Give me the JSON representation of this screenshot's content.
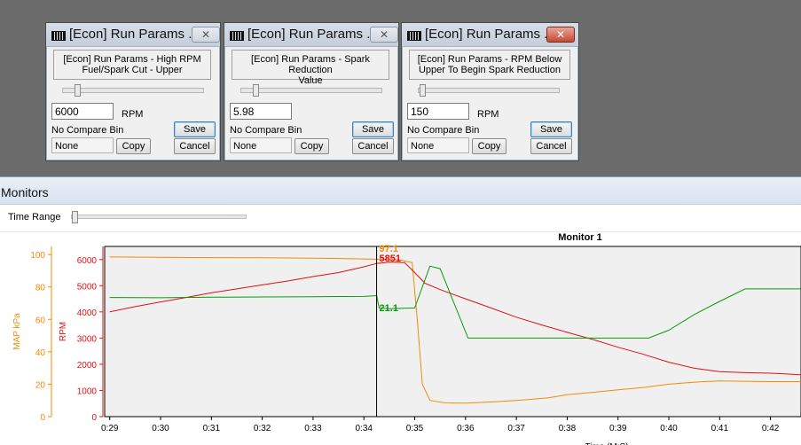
{
  "dialogs": [
    {
      "title": "[Econ] Run Params ...",
      "description_line1": "[Econ] Run Params - High RPM",
      "description_line2": "Fuel/Spark Cut - Upper",
      "value": "6000",
      "unit": "RPM",
      "save_label": "Save",
      "compare_label": "No Compare Bin",
      "compare_value": "None",
      "copy_label": "Copy",
      "cancel_label": "Cancel"
    },
    {
      "title": "[Econ] Run Params ...",
      "description_line1": "[Econ] Run Params - Spark Reduction",
      "description_line2": "Value",
      "value": "5.98",
      "unit": "",
      "save_label": "Save",
      "compare_label": "No Compare Bin",
      "compare_value": "None",
      "copy_label": "Copy",
      "cancel_label": "Cancel"
    },
    {
      "title": "[Econ] Run Params ...",
      "description_line1": "[Econ] Run Params - RPM Below",
      "description_line2": "Upper To Begin Spark Reduction",
      "value": "150",
      "unit": "RPM",
      "save_label": "Save",
      "compare_label": "No Compare Bin",
      "compare_value": "None",
      "copy_label": "Copy",
      "cancel_label": "Cancel"
    }
  ],
  "monitors": {
    "title": "Monitors",
    "time_range_label": "Time Range"
  },
  "colors": {
    "map": "#f28c00",
    "rpm": "#e01010",
    "third": "#0a9a0a",
    "cursor": "#000000"
  },
  "chart_data": {
    "type": "line",
    "title": "Monitor 1",
    "xlabel": "Time (M:S)",
    "x_ticks": [
      "0:29",
      "0:30",
      "0:31",
      "0:32",
      "0:33",
      "0:34",
      "0:35",
      "0:36",
      "0:37",
      "0:38",
      "0:39",
      "0:40",
      "0:41",
      "0:42"
    ],
    "xlim": [
      28.9,
      42.6
    ],
    "cursor_x": 34.25,
    "axes": [
      {
        "label": "MAP kPa",
        "ylim": [
          0,
          105
        ],
        "ticks": [
          0,
          20,
          40,
          60,
          80,
          100
        ],
        "side": "left-outer"
      },
      {
        "label": "RPM",
        "ylim": [
          0,
          6500
        ],
        "ticks": [
          0,
          1000,
          2000,
          3000,
          4000,
          5000,
          6000
        ],
        "side": "left-inner"
      }
    ],
    "series": [
      {
        "axis": 0,
        "cursor_label": "97.1",
        "points": [
          [
            29.0,
            98.5
          ],
          [
            30,
            98.3
          ],
          [
            31,
            98.1
          ],
          [
            32,
            98.0
          ],
          [
            33,
            97.8
          ],
          [
            34.25,
            97.1
          ],
          [
            34.7,
            96.8
          ],
          [
            34.95,
            95
          ],
          [
            35.05,
            60
          ],
          [
            35.15,
            20
          ],
          [
            35.3,
            10
          ],
          [
            35.6,
            8.5
          ],
          [
            36,
            8.3
          ],
          [
            36.5,
            9
          ],
          [
            37,
            10
          ],
          [
            37.6,
            11.5
          ],
          [
            38,
            13.5
          ],
          [
            38.5,
            15
          ],
          [
            39,
            16.5
          ],
          [
            39.5,
            18
          ],
          [
            40,
            20
          ],
          [
            40.6,
            21.5
          ],
          [
            41,
            22
          ],
          [
            41.5,
            21.8
          ],
          [
            42,
            21.6
          ],
          [
            42.6,
            21.6
          ]
        ]
      },
      {
        "axis": 1,
        "cursor_label": "5851",
        "points": [
          [
            29.0,
            4000
          ],
          [
            29.5,
            4200
          ],
          [
            30,
            4380
          ],
          [
            30.5,
            4550
          ],
          [
            31,
            4730
          ],
          [
            31.5,
            4880
          ],
          [
            32,
            5030
          ],
          [
            32.5,
            5180
          ],
          [
            33,
            5350
          ],
          [
            33.5,
            5500
          ],
          [
            34,
            5720
          ],
          [
            34.25,
            5851
          ],
          [
            34.5,
            5900
          ],
          [
            34.8,
            5880
          ],
          [
            35,
            5500
          ],
          [
            35.2,
            5100
          ],
          [
            35.5,
            4850
          ],
          [
            36,
            4500
          ],
          [
            36.5,
            4150
          ],
          [
            37,
            3800
          ],
          [
            37.5,
            3500
          ],
          [
            38,
            3220
          ],
          [
            38.5,
            2950
          ],
          [
            39,
            2650
          ],
          [
            39.5,
            2380
          ],
          [
            40,
            2080
          ],
          [
            40.5,
            1850
          ],
          [
            41,
            1720
          ],
          [
            41.5,
            1680
          ],
          [
            42,
            1660
          ],
          [
            42.6,
            1600
          ]
        ]
      },
      {
        "axis": 1,
        "cursor_label": "21.1",
        "points": [
          [
            29.0,
            4550
          ],
          [
            30,
            4540
          ],
          [
            31,
            4560
          ],
          [
            32,
            4570
          ],
          [
            33,
            4580
          ],
          [
            34.0,
            4590
          ],
          [
            34.25,
            4620
          ],
          [
            34.3,
            4150
          ],
          [
            34.5,
            4120
          ],
          [
            35,
            4150
          ],
          [
            35.3,
            5750
          ],
          [
            35.5,
            5650
          ],
          [
            36.05,
            3000
          ],
          [
            36.5,
            3000
          ],
          [
            37,
            3000
          ],
          [
            38,
            3000
          ],
          [
            39,
            3000
          ],
          [
            39.6,
            3000
          ],
          [
            40,
            3300
          ],
          [
            40.5,
            3900
          ],
          [
            41,
            4400
          ],
          [
            41.5,
            4880
          ],
          [
            42,
            4880
          ],
          [
            42.6,
            4880
          ]
        ]
      }
    ]
  }
}
